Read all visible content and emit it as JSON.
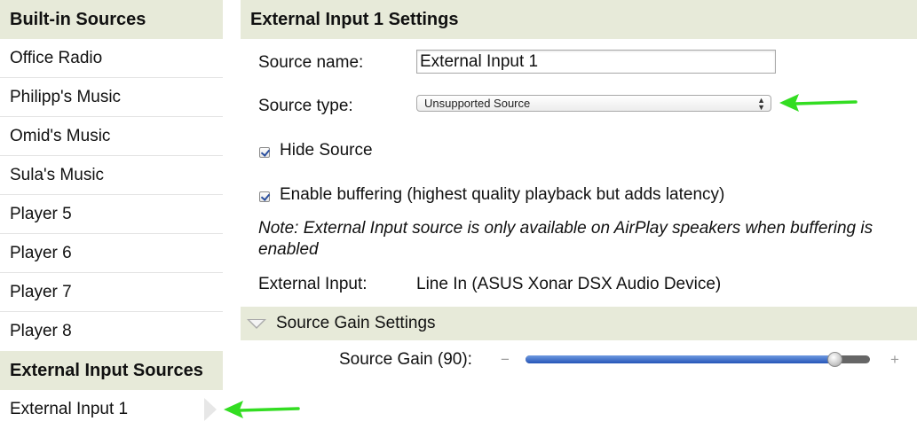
{
  "sidebar": {
    "builtin_header": "Built-in Sources",
    "builtin_items": [
      "Office Radio",
      "Philipp's Music",
      "Omid's Music",
      "Sula's Music",
      "Player 5",
      "Player 6",
      "Player 7",
      "Player 8"
    ],
    "external_header": "External Input Sources",
    "external_items": [
      "External Input 1"
    ]
  },
  "main": {
    "header": "External Input 1 Settings",
    "source_name_label": "Source name:",
    "source_name_value": "External Input 1",
    "source_type_label": "Source type:",
    "source_type_value": "Unsupported Source",
    "hide_source_label": "Hide Source",
    "hide_source_checked": true,
    "buffering_label": "Enable buffering (highest quality playback but adds latency)",
    "buffering_checked": true,
    "note": "Note: External Input source is only available on AirPlay speakers when buffering is enabled",
    "external_input_label": "External Input:",
    "external_input_value": "Line In (ASUS Xonar DSX Audio Device)"
  },
  "gain": {
    "section_title": "Source Gain Settings",
    "label": "Source Gain (90):",
    "value_fraction": 0.9,
    "minus": "−",
    "plus": "+"
  },
  "colors": {
    "header_bg": "#e7ead9",
    "annotation_arrow": "#33dd22",
    "slider_fill": "#2a5bbf"
  }
}
